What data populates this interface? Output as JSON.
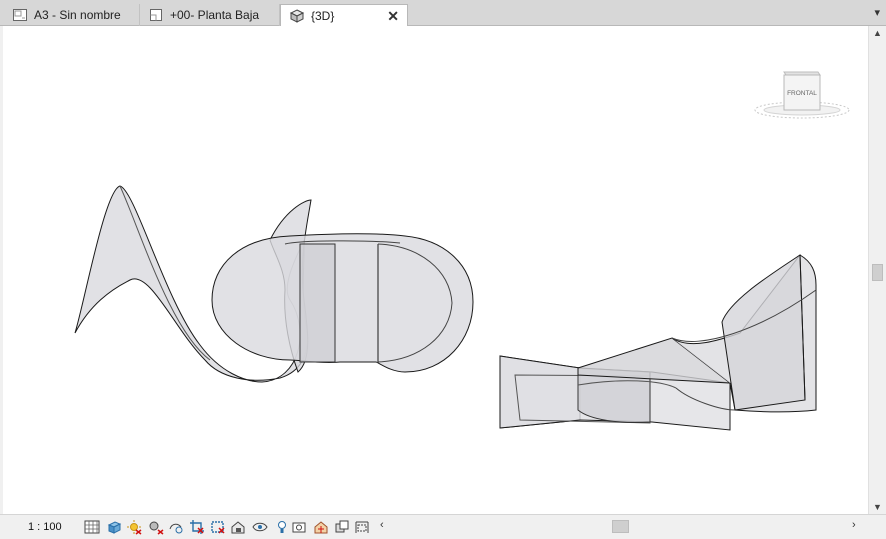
{
  "tabs": [
    {
      "label": "A3 - Sin nombre",
      "icon": "sheet-icon",
      "active": false
    },
    {
      "label": "+00- Planta Baja",
      "icon": "floor-plan-icon",
      "active": false
    },
    {
      "label": "{3D}",
      "icon": "3d-view-icon",
      "active": true
    }
  ],
  "tab_close_glyph": "✕",
  "tab_menu_glyph": "▾",
  "viewcube": {
    "face_label": "FRONTAL"
  },
  "status": {
    "scale": "1 : 100",
    "icons": [
      "detail-level-icon",
      "visual-style-icon",
      "sun-path-icon",
      "shadows-icon",
      "show-rendering-icon",
      "crop-view-icon",
      "show-crop-icon",
      "unlock-3d-view-icon",
      "temporary-hide-icon",
      "reveal-hidden-icon",
      "temporary-view-properties-icon",
      "show-analytical-model-icon",
      "highlight-displacement-icon",
      "reveal-constraints-icon"
    ],
    "left_arrow": "‹",
    "right_arrow": "›"
  },
  "scrollbar": {
    "up": "▲",
    "down": "▼"
  }
}
